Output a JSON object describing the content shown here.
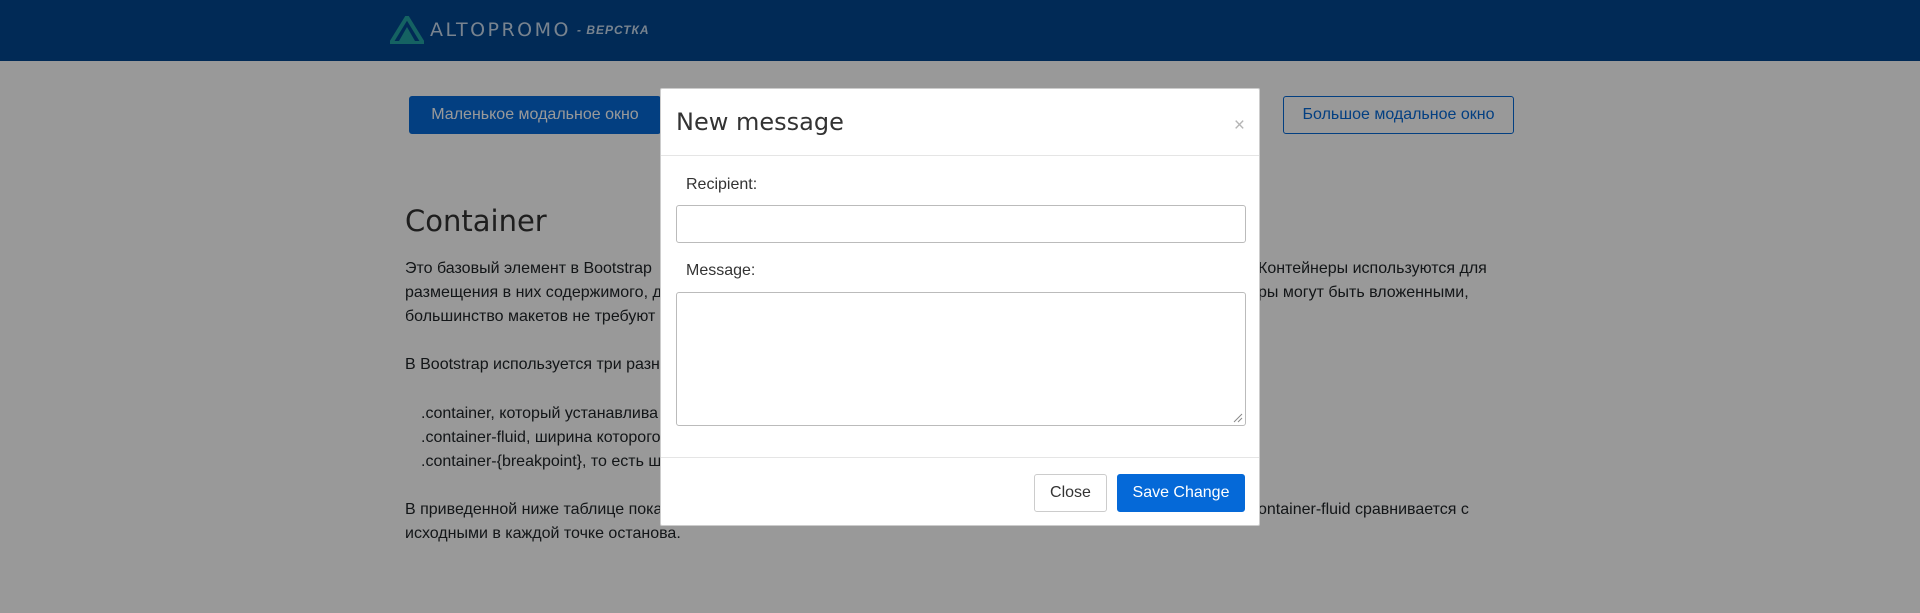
{
  "brand": {
    "name": "ALTOPROMO",
    "subtitle": "- ВЕРСТКА",
    "mark_color": "#23a4a4"
  },
  "buttons": {
    "small_modal": "Маленькое модальное окно",
    "large_modal": "Большое модальное окно"
  },
  "article": {
    "heading": "Container",
    "para1_lines": [
      "Это базовый элемент в Bootstrap",
      "Контейнеры используются для",
      "размещения в них содержимого, д",
      "ры могут быть вложенными,",
      "большинство макетов не требуют"
    ],
    "para2": "В Bootstrap используется три разн",
    "list": [
      ".container, который устанавлива",
      ".container-fluid, ширина которого",
      ".container-{breakpoint}, то есть ш"
    ],
    "para3_line1_left": "В приведенной ниже таблице пока",
    "para3_line1_right": "ontainer-fluid сравнивается с",
    "para3_line2": "исходными в каждой точке останова."
  },
  "modal": {
    "title": "New message",
    "close_symbol": "×",
    "recipient_label": "Recipient:",
    "recipient_value": "",
    "message_label": "Message:",
    "message_value": "",
    "close_button": "Close",
    "save_button": "Save Change"
  },
  "colors": {
    "header_bg": "#02478f",
    "primary": "#0569d8",
    "backdrop": "rgba(0,0,0,0.4)"
  }
}
